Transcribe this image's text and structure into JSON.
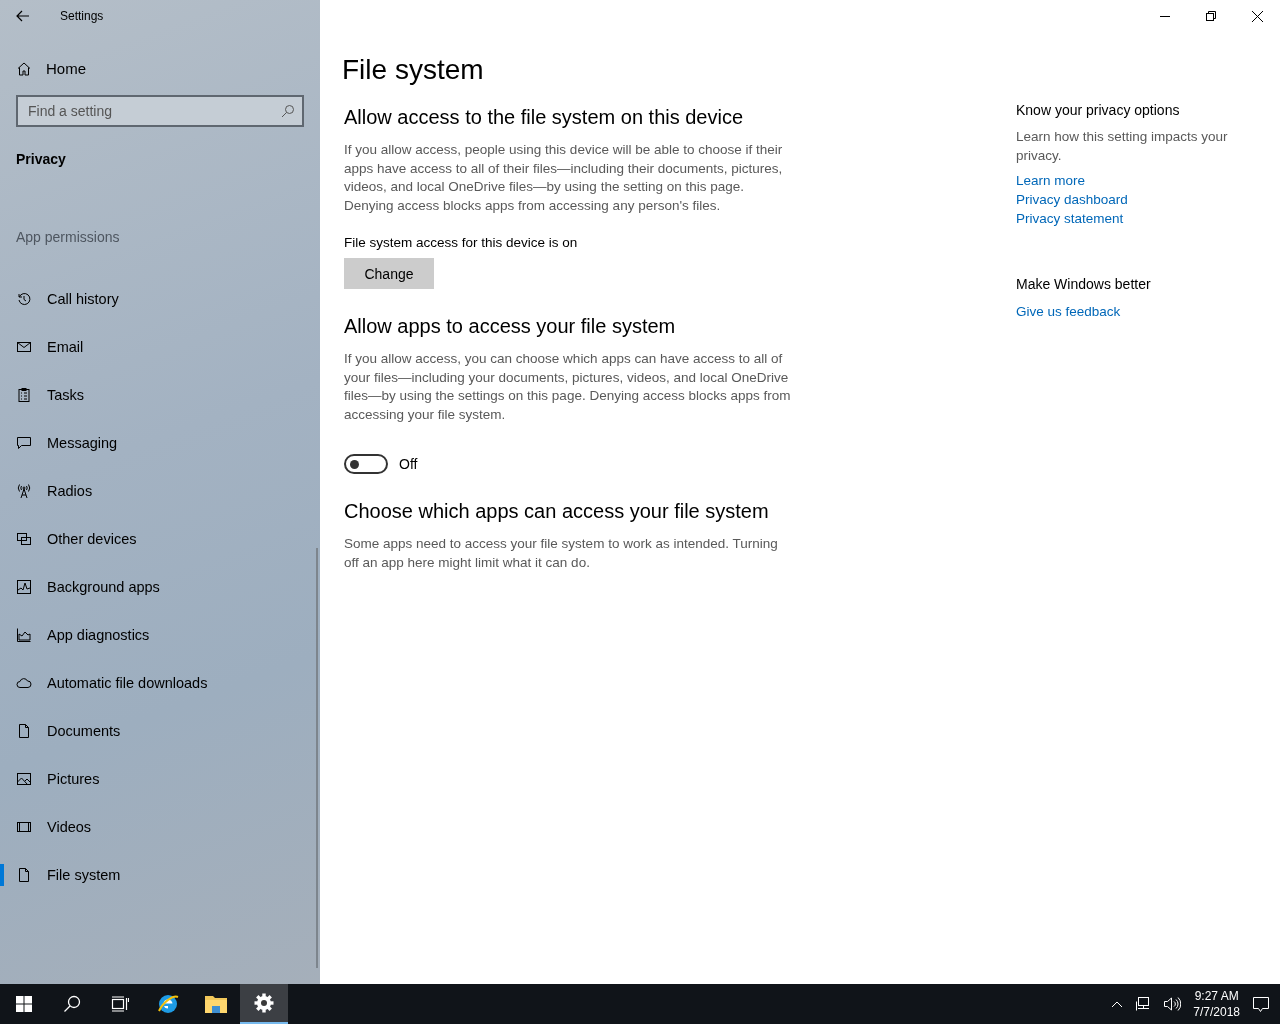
{
  "window": {
    "title": "Settings"
  },
  "sidebar": {
    "home": "Home",
    "search": {
      "placeholder": "Find a setting"
    },
    "category": "Privacy",
    "group_label": "App permissions",
    "items": [
      {
        "label": "Call history",
        "selected": false
      },
      {
        "label": "Email",
        "selected": false
      },
      {
        "label": "Tasks",
        "selected": false
      },
      {
        "label": "Messaging",
        "selected": false
      },
      {
        "label": "Radios",
        "selected": false
      },
      {
        "label": "Other devices",
        "selected": false
      },
      {
        "label": "Background apps",
        "selected": false
      },
      {
        "label": "App diagnostics",
        "selected": false
      },
      {
        "label": "Automatic file downloads",
        "selected": false
      },
      {
        "label": "Documents",
        "selected": false
      },
      {
        "label": "Pictures",
        "selected": false
      },
      {
        "label": "Videos",
        "selected": false
      },
      {
        "label": "File system",
        "selected": true
      }
    ]
  },
  "page": {
    "title": "File system",
    "sections": [
      {
        "kind": "button",
        "heading": "Allow access to the file system on this device",
        "text": "If you allow access, people using this device will be able to choose if their apps have access to all of their files—including their documents, pictures, videos, and local OneDrive files—by using the setting on this page. Denying access blocks apps from accessing any person's files.",
        "status": "File system access for this device is on",
        "button": "Change"
      },
      {
        "kind": "toggle",
        "heading": "Allow apps to access your file system",
        "text": "If you allow access, you can choose which apps can have access to all of your files—including your documents, pictures, videos, and local OneDrive files—by using the settings on this page. Denying access blocks apps from accessing your file system.",
        "on": false,
        "toggle_label": "Off"
      },
      {
        "kind": "text",
        "heading": "Choose which apps can access your file system",
        "text": "Some apps need to access your file system to work as intended. Turning off an app here might limit what it can do."
      }
    ]
  },
  "aside": [
    {
      "heading": "Know your privacy options",
      "text": "Learn how this setting impacts your privacy.",
      "links": [
        "Learn more",
        "Privacy dashboard",
        "Privacy statement"
      ]
    },
    {
      "heading": "Make Windows better",
      "links": [
        "Give us feedback"
      ]
    }
  ],
  "taskbar": {
    "apps": [
      {
        "selected": false
      },
      {
        "selected": false
      },
      {
        "selected": false
      },
      {
        "selected": false
      },
      {
        "selected": false
      },
      {
        "selected": true
      }
    ],
    "time": "9:27 AM",
    "date": "7/7/2018"
  }
}
